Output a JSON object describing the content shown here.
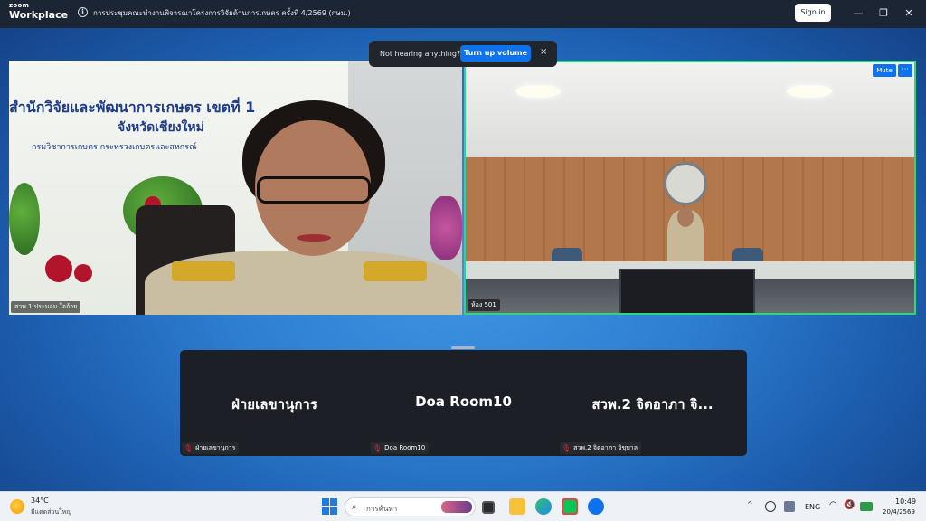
{
  "app": {
    "logo_line1": "zoom",
    "logo_line2": "Workplace",
    "meeting_title": "การประชุมคณะทำงานพิจารณาโครงการวิจัยด้านการเกษตร ครั้งที่ 4/2569 (กษม.)",
    "signin_label": "Sign in",
    "minimize_glyph": "—",
    "restore_glyph": "❐",
    "close_glyph": "✕"
  },
  "notification": {
    "text": "Not hearing anything?",
    "button_label": "Turn up volume",
    "close_glyph": "×"
  },
  "banner": {
    "line1": "สำนักวิจัยและพัฒนาการเกษตร เขตที่ 1",
    "line2": "จังหวัดเชียงใหม่",
    "line3": "กรมวิชาการเกษตร กระทรวงเกษตรและสหกรณ์"
  },
  "videos": [
    {
      "name": "สวพ.1 ประนอม ใจอ้าย"
    },
    {
      "name": "ห้อง 501",
      "mute_label": "Mute",
      "more_label": "···"
    }
  ],
  "gallery": [
    {
      "display": "ฝ่ายเลขานุการ",
      "label": "ฝ่ายเลขานุการ"
    },
    {
      "display": "Doa Room10",
      "label": "Doa Room10"
    },
    {
      "display": "สวพ.2 จิตอาภา จิ...",
      "label": "สวพ.2 จิตอาภา จิขุบาล"
    }
  ],
  "taskbar": {
    "weather_temp": "34°C",
    "weather_desc": "มีแดดส่วนใหญ่",
    "search_placeholder": "การค้นหา",
    "tray_chevron": "^",
    "language": "ENG",
    "time": "10:49",
    "date": "20/4/2569"
  },
  "colors": {
    "accent": "#0e72ed",
    "active_speaker": "#2fd67c",
    "titlebar": "#1c2533",
    "gallery_bg": "#1c1f25"
  }
}
